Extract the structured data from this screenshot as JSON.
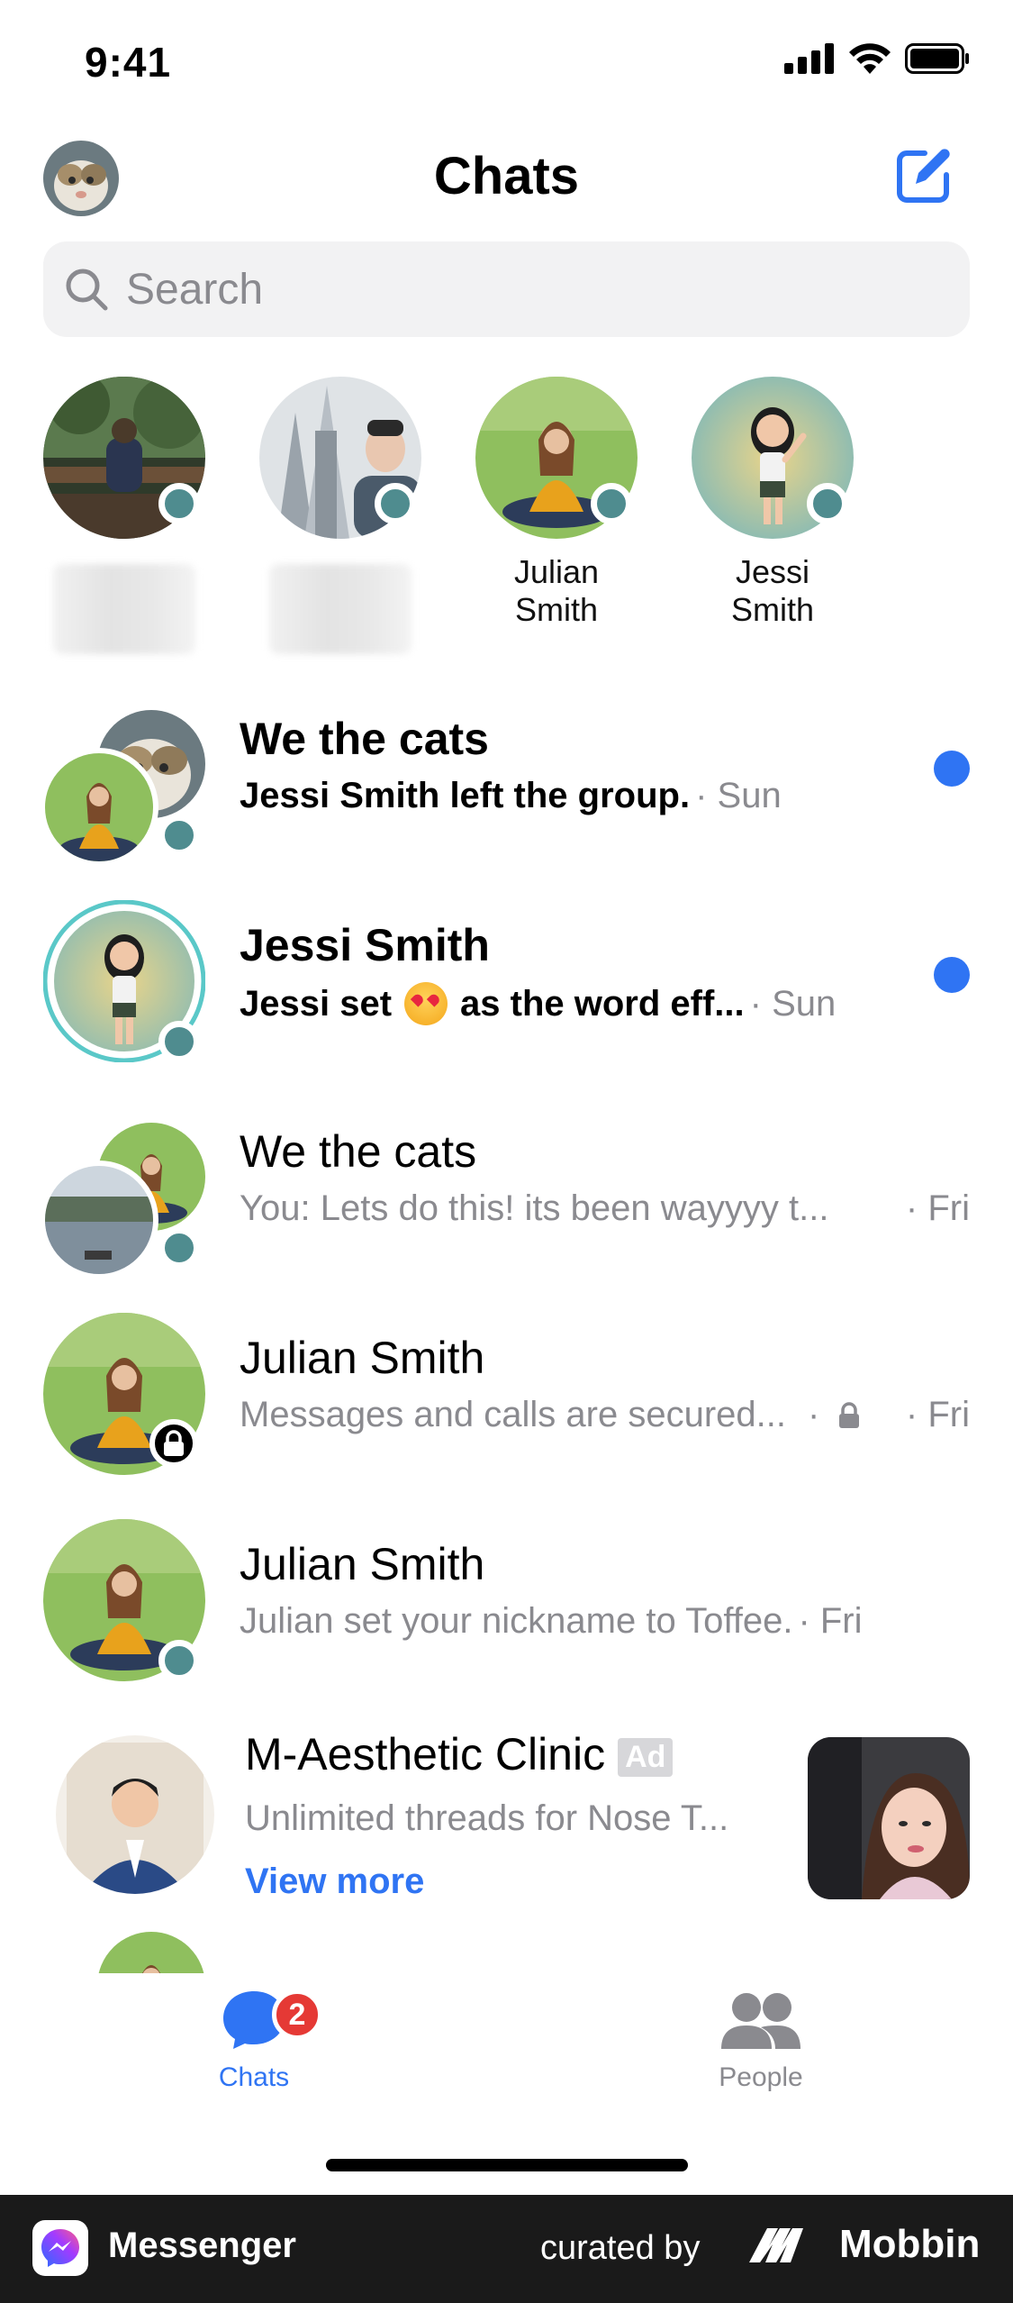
{
  "status_bar": {
    "time": "9:41"
  },
  "header": {
    "title": "Chats"
  },
  "search": {
    "placeholder": "Search"
  },
  "stories": [
    {
      "name": ""
    },
    {
      "name": ""
    },
    {
      "name": "Julian\nSmith"
    },
    {
      "name": "Jessi\nSmith"
    }
  ],
  "chats": [
    {
      "title": "We the cats",
      "preview": "Jessi Smith left the group.",
      "time": " · Sun",
      "unread": true
    },
    {
      "title": "Jessi Smith",
      "preview_before": "Jessi set",
      "preview_after": "as the word eff...",
      "time": " · Sun",
      "unread": true
    },
    {
      "title": "We the cats",
      "preview": "You: Lets do this! its been wayyyy t...",
      "time": "· Fri",
      "unread": false
    },
    {
      "title": "Julian Smith",
      "preview": "Messages and calls are secured...",
      "time": "· Fri",
      "unread": false
    },
    {
      "title": "Julian Smith",
      "preview": "Julian set your nickname to Toffee.",
      "time": " · Fri",
      "unread": false
    }
  ],
  "ad": {
    "title": "M-Aesthetic Clinic",
    "label": "Ad",
    "text": "Unlimited threads for Nose T...",
    "cta": "View more"
  },
  "tabs": [
    {
      "label": "Chats",
      "badge": "2",
      "active": true
    },
    {
      "label": "People",
      "active": false
    }
  ],
  "footer": {
    "app_name": "Messenger",
    "curated_by": "curated by",
    "brand": "Mobbin"
  },
  "colors": {
    "accent": "#2f74f3",
    "online": "#4f8c8f",
    "badge": "#e53935",
    "muted_text": "#8a8a8f"
  }
}
